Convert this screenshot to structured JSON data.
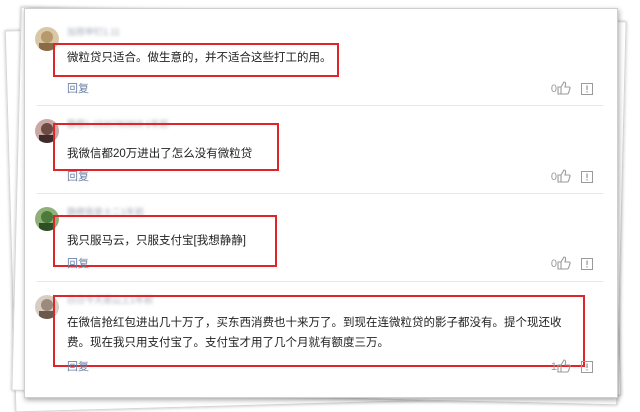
{
  "comments": [
    {
      "username": "加邢申钉1.11",
      "text_lines": [
        "微粒贷只适合。做生意的，并不适合这些打工的用。"
      ],
      "reply_label": "回复",
      "likes": "0",
      "avatar_color": "#b69a6c"
    },
    {
      "username": "静穆1-1530780868 1年前",
      "text_lines": [
        "我微信都20万进出了怎么没有微粒贷"
      ],
      "reply_label": "回复",
      "likes": "0",
      "avatar_color": "#6e4a44"
    },
    {
      "username": "静穆我是士二1年前",
      "text_lines": [
        "我只服马云，只服支付宝[我想静静]"
      ],
      "reply_label": "回复",
      "likes": "0",
      "avatar_color": "#4b7a3a"
    },
    {
      "username": "白日今天是山上1年前",
      "text_lines": [
        "在微信抢红包进出几十万了，买东西消费也十来万了。到现在连微粒贷的影子都没有。提个现还收",
        "费。现在我只用支付宝了。支付宝才用了几个月就有额度三万。"
      ],
      "reply_label": "回复",
      "likes": "1",
      "avatar_color": "#9c8a7a"
    }
  ],
  "colors": {
    "highlight_border": "#e0252a",
    "reply_link": "#6b7fa3",
    "icon_gray": "#9a9a9a"
  },
  "icons": {
    "like": "thumbs-up-icon",
    "report": "report-icon"
  }
}
